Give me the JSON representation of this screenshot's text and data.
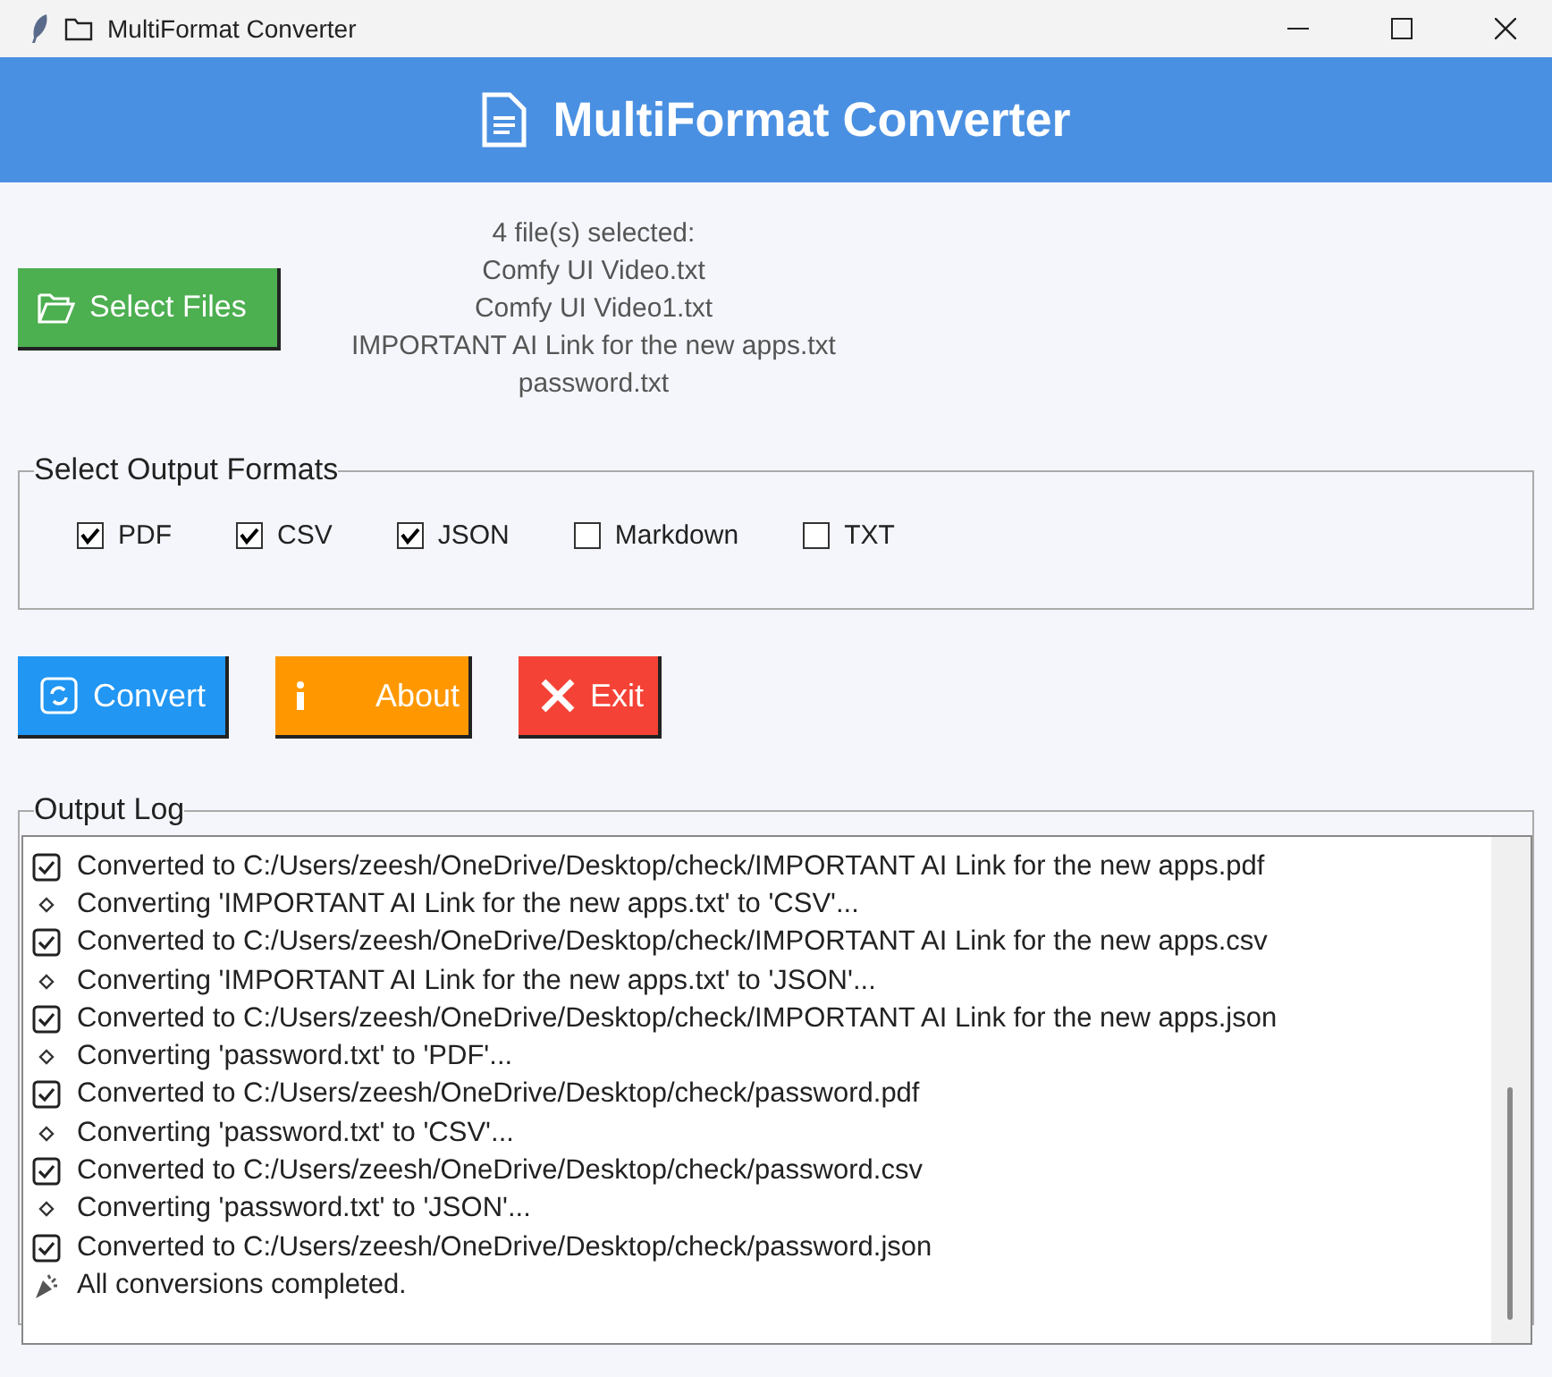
{
  "window": {
    "title": "MultiFormat Converter"
  },
  "header": {
    "title": "MultiFormat Converter"
  },
  "select_button": {
    "label": "Select Files"
  },
  "selected_files": [
    "4 file(s) selected:",
    "Comfy UI Video.txt",
    "Comfy UI Video1.txt",
    "IMPORTANT AI Link for the new apps.txt",
    "password.txt"
  ],
  "formats": {
    "title": "Select Output Formats",
    "options": [
      {
        "label": "PDF",
        "checked": true
      },
      {
        "label": "CSV",
        "checked": true
      },
      {
        "label": "JSON",
        "checked": true
      },
      {
        "label": "Markdown",
        "checked": false
      },
      {
        "label": "TXT",
        "checked": false
      }
    ]
  },
  "actions": [
    {
      "kind": "convert",
      "label": "Convert"
    },
    {
      "kind": "about",
      "label": "About"
    },
    {
      "kind": "exit",
      "label": "Exit"
    }
  ],
  "log": {
    "title": "Output Log",
    "lines": [
      {
        "kind": "done",
        "text": "Converted to C:/Users/zeesh/OneDrive/Desktop/check/IMPORTANT AI Link for the new apps.pdf"
      },
      {
        "kind": "progress",
        "text": "Converting 'IMPORTANT AI Link for the new apps.txt' to 'CSV'..."
      },
      {
        "kind": "done",
        "text": "Converted to C:/Users/zeesh/OneDrive/Desktop/check/IMPORTANT AI Link for the new apps.csv"
      },
      {
        "kind": "progress",
        "text": "Converting 'IMPORTANT AI Link for the new apps.txt' to 'JSON'..."
      },
      {
        "kind": "done",
        "text": "Converted to C:/Users/zeesh/OneDrive/Desktop/check/IMPORTANT AI Link for the new apps.json"
      },
      {
        "kind": "progress",
        "text": "Converting 'password.txt' to 'PDF'..."
      },
      {
        "kind": "done",
        "text": "Converted to C:/Users/zeesh/OneDrive/Desktop/check/password.pdf"
      },
      {
        "kind": "progress",
        "text": "Converting 'password.txt' to 'CSV'..."
      },
      {
        "kind": "done",
        "text": "Converted to C:/Users/zeesh/OneDrive/Desktop/check/password.csv"
      },
      {
        "kind": "progress",
        "text": "Converting 'password.txt' to 'JSON'..."
      },
      {
        "kind": "done",
        "text": "Converted to C:/Users/zeesh/OneDrive/Desktop/check/password.json"
      },
      {
        "kind": "finished",
        "text": "All conversions completed."
      }
    ]
  }
}
